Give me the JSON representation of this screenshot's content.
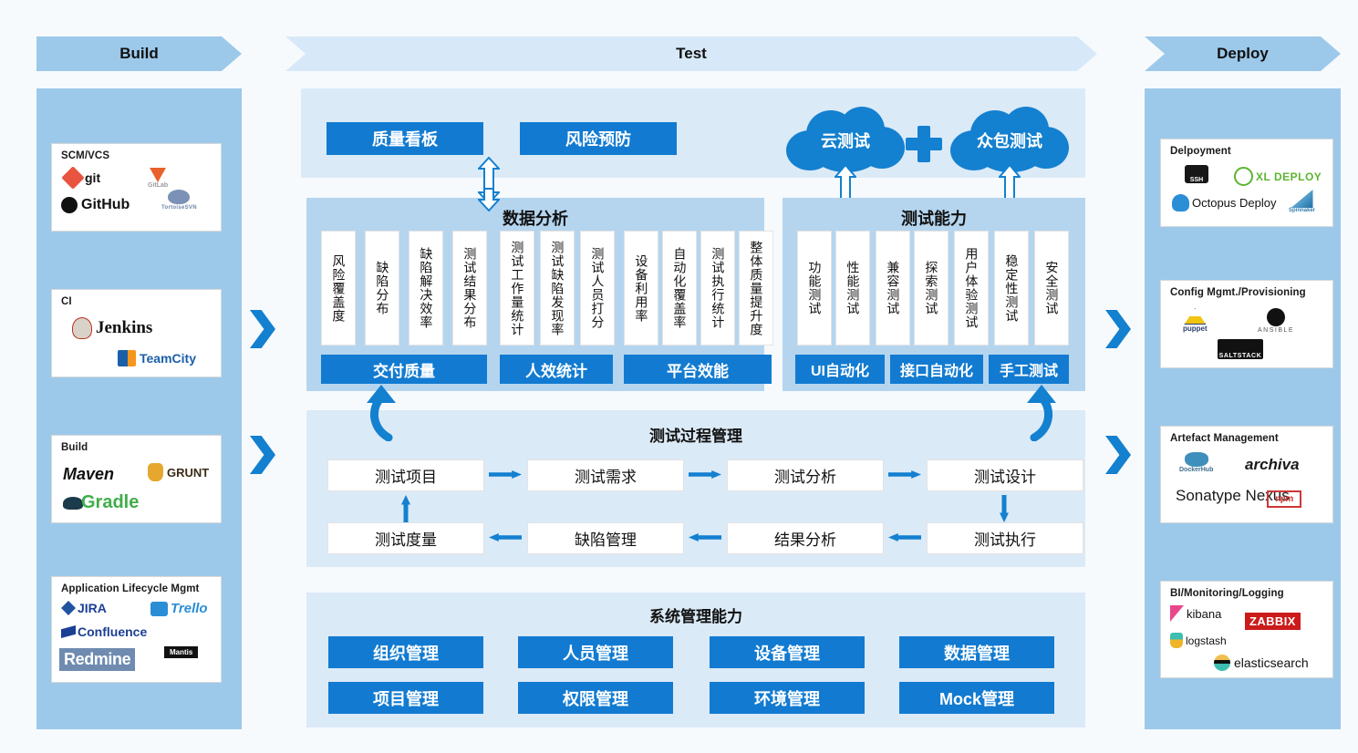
{
  "banners": {
    "build": "Build",
    "test": "Test",
    "deploy": "Deploy"
  },
  "left_column": {
    "cards": [
      {
        "caption": "SCM/VCS",
        "tools": [
          "git",
          "GitLab",
          "GitHub",
          "TortoiseSVN"
        ]
      },
      {
        "caption": "CI",
        "tools": [
          "Jenkins",
          "TeamCity"
        ]
      },
      {
        "caption": "Build",
        "tools": [
          "Maven",
          "GRUNT",
          "Gradle"
        ]
      },
      {
        "caption": "Application Lifecycle Mgmt",
        "tools": [
          "JIRA",
          "Trello",
          "Confluence",
          "Redmine",
          "Mantis"
        ]
      }
    ]
  },
  "right_column": {
    "cards": [
      {
        "caption": "Delpoyment",
        "tools": [
          "SSH",
          "XL DEPLOY",
          "Octopus Deploy",
          "Spinnaker"
        ]
      },
      {
        "caption": "Config Mgmt./Provisioning",
        "tools": [
          "puppet",
          "ANSIBLE",
          "SALTSTACK"
        ]
      },
      {
        "caption": "Artefact Management",
        "tools": [
          "DockerHub",
          "archiva",
          "Sonatype Nexus",
          "npm"
        ]
      },
      {
        "caption": "BI/Monitoring/Logging",
        "tools": [
          "kibana",
          "ZABBIX",
          "logstash",
          "elasticsearch"
        ]
      }
    ]
  },
  "top_boxes": {
    "quality_board": "质量看板",
    "risk_prevention": "风险预防"
  },
  "clouds": {
    "cloud_test": "云测试",
    "crowd_test": "众包测试",
    "plus": "+"
  },
  "data_analysis": {
    "title": "数据分析",
    "items": [
      "风险覆盖度",
      "缺陷分布",
      "缺陷解决效率",
      "测试结果分布",
      "测试工作量统计",
      "测试缺陷发现率",
      "测试人员打分",
      "设备利用率",
      "自动化覆盖率",
      "测试执行统计",
      "整体质量提升度"
    ],
    "groups": [
      "交付质量",
      "人效统计",
      "平台效能"
    ]
  },
  "test_capability": {
    "title": "测试能力",
    "items": [
      "功能测试",
      "性能测试",
      "兼容测试",
      "探索测试",
      "用户体验测试",
      "稳定性测试",
      "安全测试"
    ],
    "groups": [
      "UI自动化",
      "接口自动化",
      "手工测试"
    ]
  },
  "process_management": {
    "title": "测试过程管理",
    "row1": [
      "测试项目",
      "测试需求",
      "测试分析",
      "测试设计"
    ],
    "row2": [
      "测试度量",
      "缺陷管理",
      "结果分析",
      "测试执行"
    ]
  },
  "system_management": {
    "title": "系统管理能力",
    "row1": [
      "组织管理",
      "人员管理",
      "设备管理",
      "数据管理"
    ],
    "row2": [
      "项目管理",
      "权限管理",
      "环境管理",
      "Mock管理"
    ]
  },
  "colors": {
    "accent_blue": "#127bd1",
    "banner_blue": "#9cc9ea",
    "panel_blue": "#dbeaf7",
    "panel_sub_blue": "#b5d5ef"
  }
}
